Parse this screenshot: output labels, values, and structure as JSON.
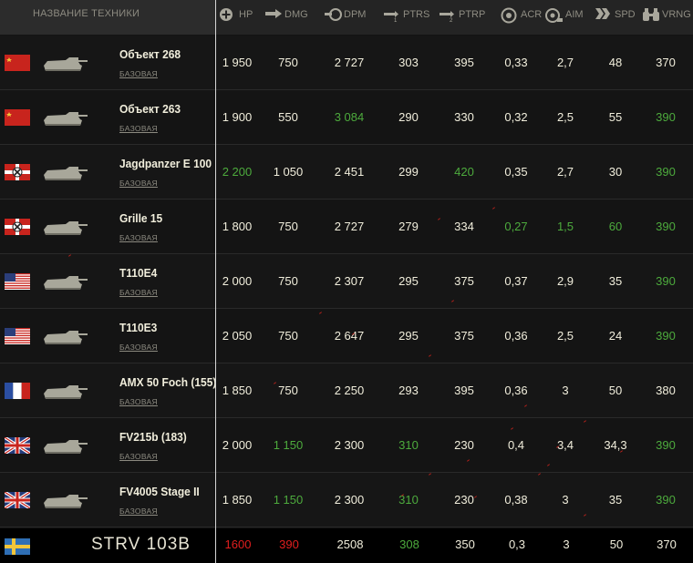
{
  "header": {
    "name_label": "НАЗВАНИЕ ТЕХНИКИ",
    "columns": [
      {
        "label": "HP",
        "icon": "plus-circle-icon"
      },
      {
        "label": "DMG",
        "icon": "shell-damage-icon"
      },
      {
        "label": "DPM",
        "icon": "damage-per-minute-icon"
      },
      {
        "label": "PTRS",
        "icon": "shell-1-penetration-icon"
      },
      {
        "label": "PTRP",
        "icon": "shell-2-penetration-icon"
      },
      {
        "label": "ACR",
        "icon": "accuracy-target-icon"
      },
      {
        "label": "AIM",
        "icon": "aim-time-icon"
      },
      {
        "label": "SPD",
        "icon": "speed-chevrons-icon"
      },
      {
        "label": "VRNG",
        "icon": "binoculars-icon"
      }
    ]
  },
  "colors": {
    "good": "#4dab3d",
    "bad": "#e21e1e",
    "normal": "#f1eedc"
  },
  "rows": [
    {
      "nation": "ussr",
      "name": "Объект 268",
      "sub": "БАЗОВАЯ",
      "values": [
        "1 950",
        "750",
        "2 727",
        "303",
        "395",
        "0,33",
        "2,7",
        "48",
        "370"
      ],
      "highlight": [
        "",
        "",
        "",
        "",
        "",
        "",
        "",
        "",
        ""
      ]
    },
    {
      "nation": "ussr",
      "name": "Объект 263",
      "sub": "БАЗОВАЯ",
      "values": [
        "1 900",
        "550",
        "3 084",
        "290",
        "330",
        "0,32",
        "2,5",
        "55",
        "390"
      ],
      "highlight": [
        "",
        "",
        "good",
        "",
        "",
        "",
        "",
        "",
        "good"
      ]
    },
    {
      "nation": "germany",
      "name": "Jagdpanzer E 100",
      "sub": "БАЗОВАЯ",
      "values": [
        "2 200",
        "1 050",
        "2 451",
        "299",
        "420",
        "0,35",
        "2,7",
        "30",
        "390"
      ],
      "highlight": [
        "good",
        "",
        "",
        "",
        "good",
        "",
        "",
        "",
        "good"
      ]
    },
    {
      "nation": "germany",
      "name": "Grille 15",
      "sub": "БАЗОВАЯ",
      "values": [
        "1 800",
        "750",
        "2 727",
        "279",
        "334",
        "0,27",
        "1,5",
        "60",
        "390"
      ],
      "highlight": [
        "",
        "",
        "",
        "",
        "",
        "good",
        "good",
        "good",
        "good"
      ]
    },
    {
      "nation": "usa",
      "name": "T110E4",
      "sub": "БАЗОВАЯ",
      "values": [
        "2 000",
        "750",
        "2 307",
        "295",
        "375",
        "0,37",
        "2,9",
        "35",
        "390"
      ],
      "highlight": [
        "",
        "",
        "",
        "",
        "",
        "",
        "",
        "",
        "good"
      ]
    },
    {
      "nation": "usa",
      "name": "T110E3",
      "sub": "БАЗОВАЯ",
      "values": [
        "2 050",
        "750",
        "2 647",
        "295",
        "375",
        "0,36",
        "2,5",
        "24",
        "390"
      ],
      "highlight": [
        "",
        "",
        "",
        "",
        "",
        "",
        "",
        "",
        "good"
      ]
    },
    {
      "nation": "france",
      "name": "AMX 50 Foch (155)",
      "sub": "БАЗОВАЯ",
      "values": [
        "1 850",
        "750",
        "2 250",
        "293",
        "395",
        "0,36",
        "3",
        "50",
        "380"
      ],
      "highlight": [
        "",
        "",
        "",
        "",
        "",
        "",
        "",
        "",
        ""
      ]
    },
    {
      "nation": "uk",
      "name": "FV215b (183)",
      "sub": "БАЗОВАЯ",
      "values": [
        "2 000",
        "1 150",
        "2 300",
        "310",
        "230",
        "0,4",
        "3,4",
        "34,3",
        "390"
      ],
      "highlight": [
        "",
        "good",
        "",
        "good",
        "",
        "",
        "",
        "",
        "good"
      ]
    },
    {
      "nation": "uk",
      "name": "FV4005 Stage II",
      "sub": "БАЗОВАЯ",
      "values": [
        "1 850",
        "1 150",
        "2 300",
        "310",
        "230",
        "0,38",
        "3",
        "35",
        "390"
      ],
      "highlight": [
        "",
        "good",
        "",
        "good",
        "",
        "",
        "",
        "",
        "good"
      ]
    }
  ],
  "last_row": {
    "nation": "sweden",
    "name": "STRV 103B",
    "values": [
      "1600",
      "390",
      "2508",
      "308",
      "350",
      "0,3",
      "3",
      "50",
      "370"
    ],
    "highlight": [
      "bad",
      "bad",
      "",
      "good",
      "",
      "",
      "",
      "",
      ""
    ]
  }
}
